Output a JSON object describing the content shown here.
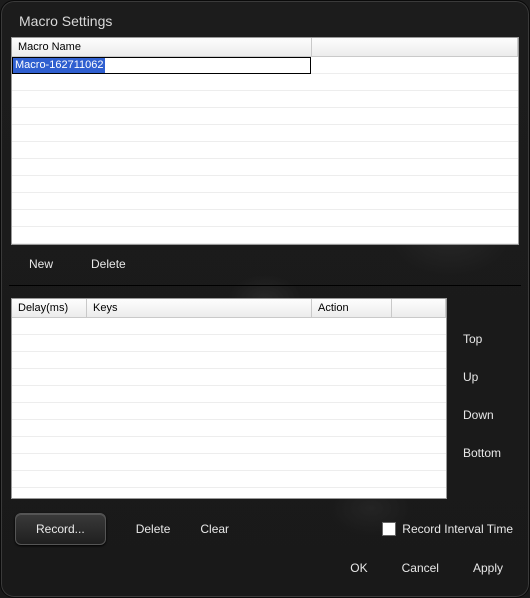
{
  "title": "Macro Settings",
  "macroGrid": {
    "columns": {
      "name": "Macro Name"
    },
    "editingValue": "Macro-162711062"
  },
  "topButtons": {
    "new": "New",
    "delete": "Delete"
  },
  "stepsGrid": {
    "columns": {
      "delay": "Delay(ms)",
      "keys": "Keys",
      "action": "Action"
    }
  },
  "sideButtons": {
    "top": "Top",
    "up": "Up",
    "down": "Down",
    "bottom": "Bottom"
  },
  "bottom": {
    "record": "Record...",
    "delete": "Delete",
    "clear": "Clear",
    "recordInterval": "Record Interval Time",
    "ok": "OK",
    "cancel": "Cancel",
    "apply": "Apply"
  }
}
